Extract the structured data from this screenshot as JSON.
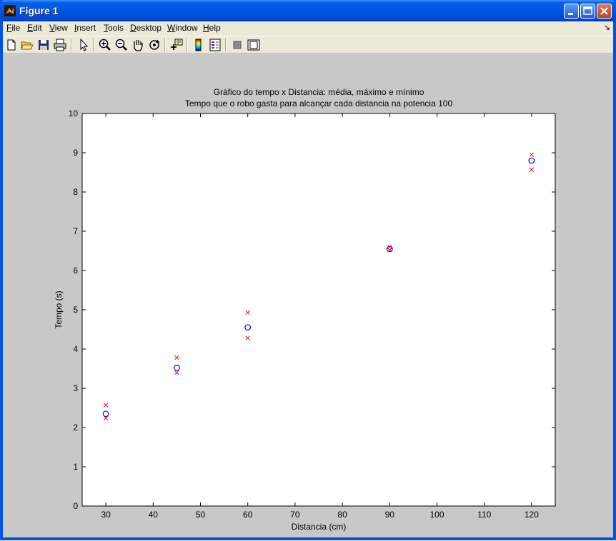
{
  "window": {
    "title": "Figure 1"
  },
  "menu": {
    "items": [
      {
        "pre": "",
        "u": "F",
        "post": "ile"
      },
      {
        "pre": "",
        "u": "E",
        "post": "dit"
      },
      {
        "pre": "",
        "u": "V",
        "post": "iew"
      },
      {
        "pre": "",
        "u": "I",
        "post": "nsert"
      },
      {
        "pre": "",
        "u": "T",
        "post": "ools"
      },
      {
        "pre": "",
        "u": "D",
        "post": "esktop"
      },
      {
        "pre": "",
        "u": "W",
        "post": "indow"
      },
      {
        "pre": "",
        "u": "H",
        "post": "elp"
      }
    ]
  },
  "toolbar": {
    "icons": [
      "new-file-icon",
      "open-file-icon",
      "save-icon",
      "print-icon",
      "edit-plot-arrow-icon",
      "zoom-in-icon",
      "zoom-out-icon",
      "pan-hand-icon",
      "rotate-3d-icon",
      "data-cursor-icon",
      "insert-colorbar-icon",
      "insert-legend-icon",
      "hide-plot-tools-icon",
      "show-plot-tools-icon"
    ]
  },
  "colors": {
    "figure_bg": "#c8c8c8",
    "mean": "#0000ff",
    "extreme": "#ff0000"
  },
  "chart_data": {
    "type": "scatter",
    "title": "Gráfico do tempo x Distancia: média, máximo e mínimo",
    "subtitle": "Tempo que o robo gasta para alcançar cada distancia na potencia 100",
    "xlabel": "Distancia (cm)",
    "ylabel": "Tempo (s)",
    "xlim": [
      25,
      125
    ],
    "ylim": [
      0,
      10
    ],
    "xticks": [
      "30",
      "40",
      "50",
      "60",
      "70",
      "80",
      "90",
      "100",
      "110",
      "120"
    ],
    "yticks": [
      "0",
      "1",
      "2",
      "3",
      "4",
      "5",
      "6",
      "7",
      "8",
      "9",
      "10"
    ],
    "grid": false,
    "series": [
      {
        "marker": "o",
        "color": "#0000ff",
        "x": [
          30,
          45,
          60,
          90,
          120
        ],
        "y": [
          2.35,
          3.52,
          4.55,
          6.55,
          8.8
        ]
      },
      {
        "marker": "x",
        "color": "#ff0000",
        "x": [
          30,
          45,
          60,
          90,
          120
        ],
        "y": [
          2.57,
          3.78,
          4.93,
          6.6,
          8.95
        ]
      },
      {
        "marker": "x",
        "color": "#ff0000",
        "x": [
          30,
          45,
          60,
          90,
          120
        ],
        "y": [
          2.24,
          3.4,
          4.28,
          6.52,
          8.57
        ]
      }
    ]
  }
}
